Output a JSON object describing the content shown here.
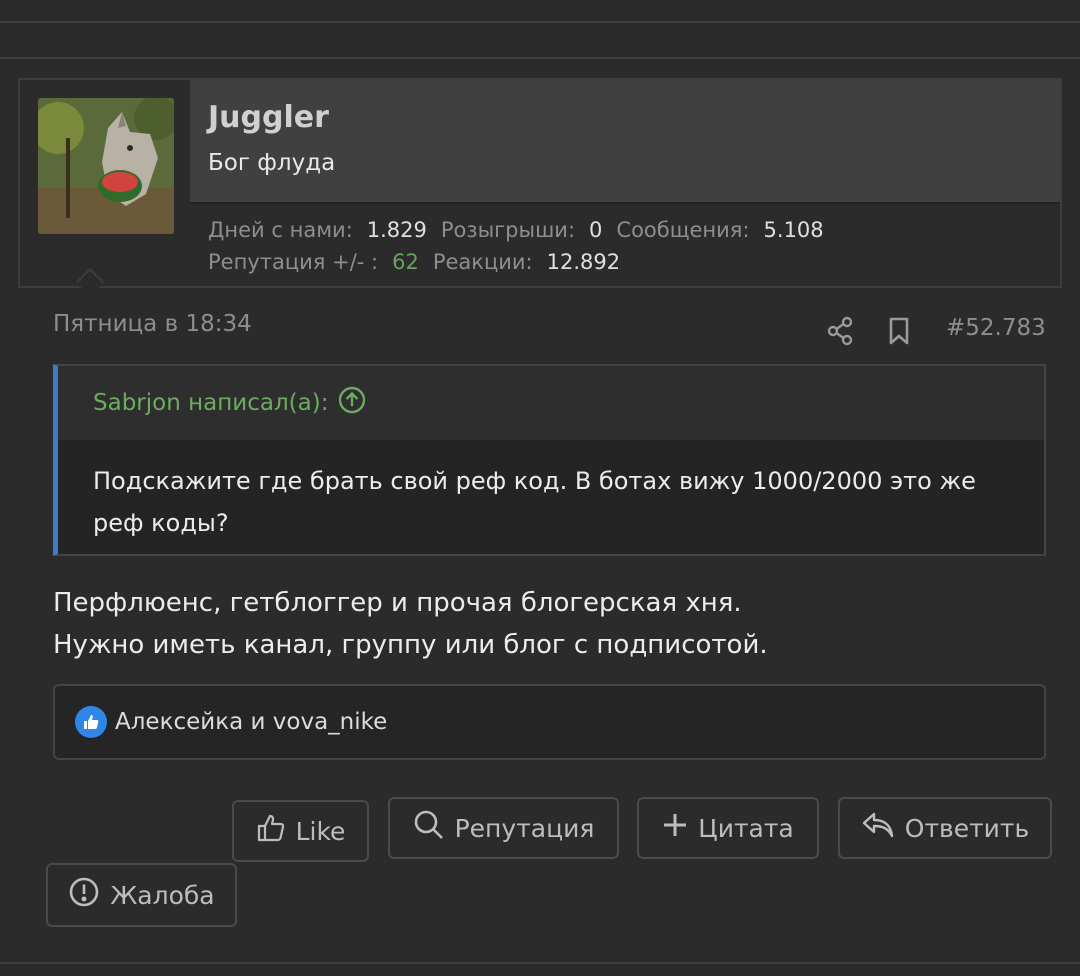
{
  "author": {
    "name": "Juggler",
    "title": "Бог флуда",
    "stats": {
      "days_label": "Дней с нами:",
      "days_value": "1.829",
      "giveaways_label": "Розыгрыши:",
      "giveaways_value": "0",
      "messages_label": "Сообщения:",
      "messages_value": "5.108",
      "reputation_label": "Репутация +/- :",
      "reputation_value": "62",
      "reactions_label": "Реакции:",
      "reactions_value": "12.892"
    }
  },
  "post": {
    "date": "Пятница в 18:34",
    "number": "#52.783",
    "quote": {
      "author_line": "Sabrjon написал(а):",
      "text": "Подскажите где брать свой реф код. В ботах вижу 1000/2000 это же реф коды?"
    },
    "message_line1": "Перфлюенс, гетблоггер и прочая блогерская хня.",
    "message_line2": "Нужно иметь канал, группу или блог с подписотой.",
    "reactions_text": "Алексейка и vova_nike"
  },
  "actions": {
    "like": "Like",
    "reputation": "Репутация",
    "quote": "Цитата",
    "reply": "Ответить",
    "report": "Жалоба"
  },
  "colors": {
    "accent_green": "#67a35c",
    "quote_bar": "#3d7dc8",
    "like_badge": "#2e86e6"
  }
}
